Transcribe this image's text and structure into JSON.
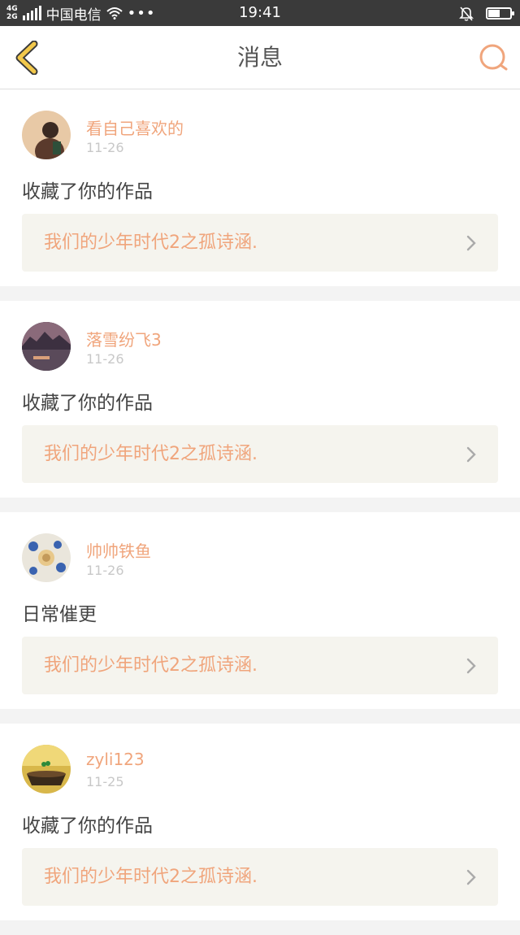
{
  "status_bar": {
    "network_top": "4G",
    "network_bottom": "2G",
    "carrier": "中国电信",
    "more": "•••",
    "time": "19:41",
    "battery_level": 0.55
  },
  "header": {
    "title": "消息"
  },
  "messages": [
    {
      "user": "看自己喜欢的",
      "date": "11-26",
      "action": "收藏了你的作品",
      "work": "我们的少年时代2之孤诗涵."
    },
    {
      "user": "落雪纷飞3",
      "date": "11-26",
      "action": "收藏了你的作品",
      "work": "我们的少年时代2之孤诗涵."
    },
    {
      "user": "帅帅铁鱼",
      "date": "11-26",
      "action": "日常催更",
      "work": "我们的少年时代2之孤诗涵."
    },
    {
      "user": "zyli123",
      "date": "11-25",
      "action": "收藏了你的作品",
      "work": "我们的少年时代2之孤诗涵."
    }
  ],
  "colors": {
    "accent": "#f0a57c",
    "back_arrow": "#f2c84b",
    "status_bar": "#3a3a3a"
  }
}
